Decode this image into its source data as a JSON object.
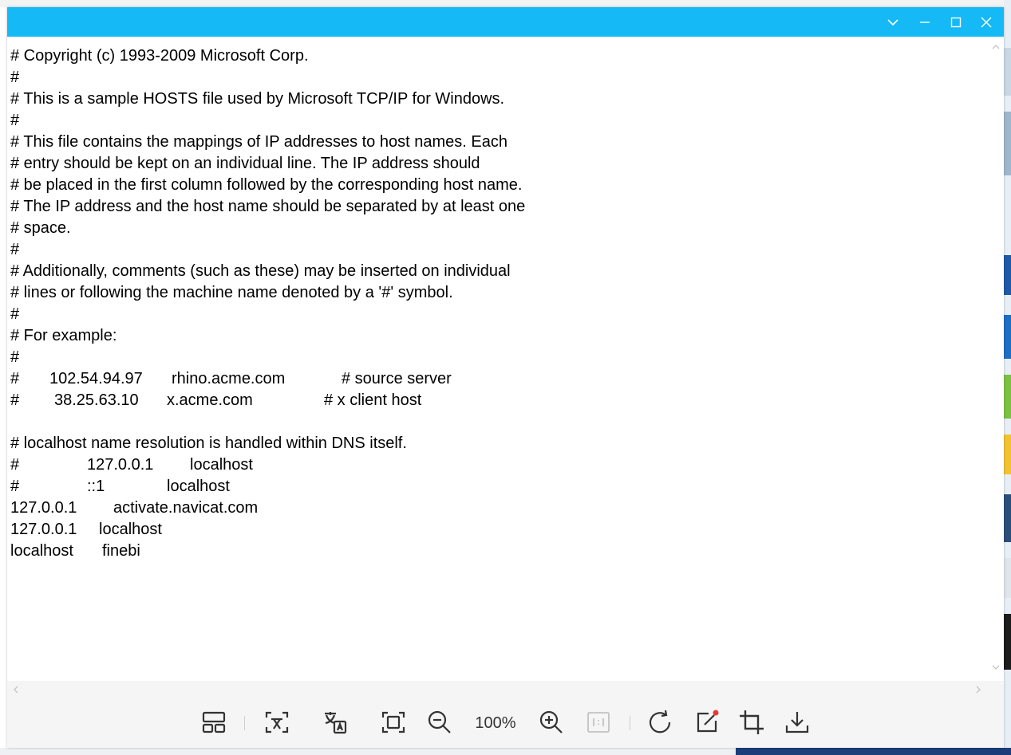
{
  "titlebar": {
    "icons": [
      "chevron-down-icon",
      "minimize-icon",
      "maximize-icon",
      "close-icon"
    ]
  },
  "file_lines": [
    [
      "# Copyright (c) 1993-2009 Microsoft Corp."
    ],
    [
      "#"
    ],
    [
      "# This is a sample HOSTS file used by Microsoft TCP/IP for Windows."
    ],
    [
      "#"
    ],
    [
      "# This file contains the mappings of IP addresses to host names. Each"
    ],
    [
      "# entry should be kept on an individual line. The IP address should"
    ],
    [
      "# be placed in the first column followed by the corresponding host name."
    ],
    [
      "# The IP address and the host name should be separated by at least one"
    ],
    [
      "# space."
    ],
    [
      "#"
    ],
    [
      "# Additionally, comments (such as these) may be inserted on individual"
    ],
    [
      "# lines or following the machine name denoted by a '#' symbol."
    ],
    [
      "#"
    ],
    [
      "# For example:"
    ],
    [
      "#"
    ],
    [
      "#",
      "102.54.94.97",
      "rhino.acme.com",
      "# source server"
    ],
    [
      "#",
      "38.25.63.10",
      "x.acme.com",
      "# x client host"
    ],
    [
      ""
    ],
    [
      "# localhost name resolution is handled within DNS itself."
    ],
    [
      "#",
      "127.0.0.1",
      "localhost"
    ],
    [
      "#",
      "::1",
      "localhost"
    ],
    [
      "127.0.0.1",
      "activate.navicat.com"
    ],
    [
      "127.0.0.1",
      "localhost"
    ],
    [
      "localhost",
      "finebi"
    ]
  ],
  "toolbar": {
    "zoom_label": "100%",
    "icons": [
      "thumbnail-layout-icon",
      "extract-text-icon",
      "translate-icon",
      "fit-screen-icon",
      "zoom-out-icon",
      "zoom-in-icon",
      "actual-size-icon",
      "rotate-icon",
      "edit-icon",
      "crop-icon",
      "download-icon"
    ]
  },
  "colors": {
    "titlebar": "#14b9f6",
    "edit_badge": "#e53935",
    "toolbar_bg": "#f5f5f5"
  }
}
